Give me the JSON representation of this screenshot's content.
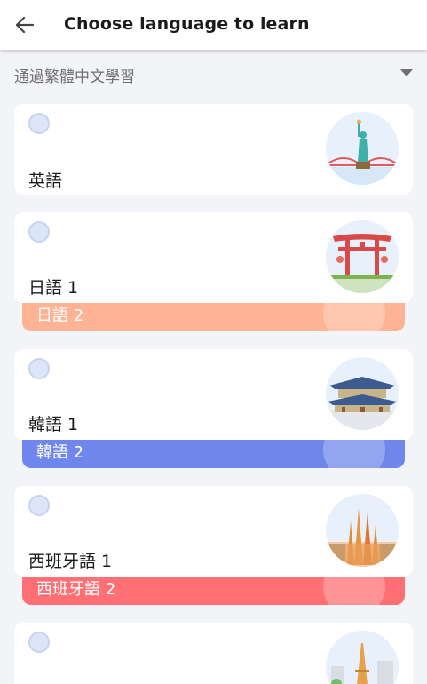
{
  "header": {
    "title": "Choose language to learn",
    "back_icon": "arrow-left-icon"
  },
  "source_language": {
    "value": "通過繁體中文學習",
    "icon": "caret-down-icon"
  },
  "languages": [
    {
      "label": "英語",
      "back_label": null,
      "back_color": null,
      "icon": "statue-of-liberty-icon"
    },
    {
      "label": "日語 1",
      "back_label": "日語 2",
      "back_color": "#ffb394",
      "icon": "torii-gate-icon"
    },
    {
      "label": "韓語 1",
      "back_label": "韓語 2",
      "back_color": "#6f86ec",
      "icon": "korean-palace-icon"
    },
    {
      "label": "西班牙語 1",
      "back_label": "西班牙語 2",
      "back_color": "#ff6f73",
      "icon": "sagrada-familia-icon"
    },
    {
      "label": "",
      "back_label": null,
      "back_color": null,
      "icon": "eiffel-tower-icon"
    }
  ]
}
